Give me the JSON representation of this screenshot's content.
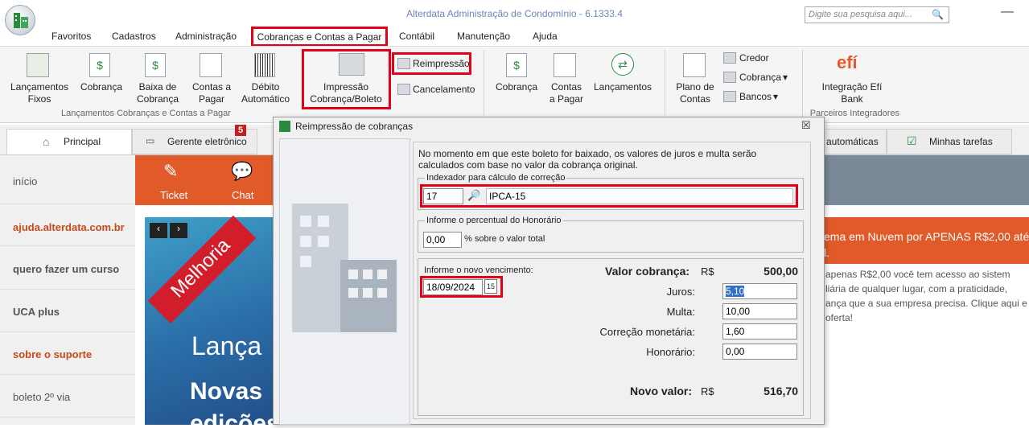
{
  "window": {
    "title": "Alterdata Administração de Condomínio - 6.1333.4",
    "search_placeholder": "Digite sua pesquisa aqui..."
  },
  "menu": [
    "Favoritos",
    "Cadastros",
    "Administração",
    "Cobranças e Contas a Pagar",
    "Contábil",
    "Manutenção",
    "Ajuda"
  ],
  "ribbon": {
    "lancamentos_fixos": "Lançamentos Fixos",
    "cobranca": "Cobrança",
    "baixa_de_cobranca": "Baixa de Cobrança",
    "contas_a_pagar": "Contas a Pagar",
    "debito_automatico": "Débito Automático",
    "impressao": "Impressão Cobrança/Boleto",
    "reimpressao": "Reimpressão",
    "cancelamento": "Cancelamento",
    "group1": "Lançamentos Cobranças e Contas a Pagar",
    "cobranca2": "Cobrança",
    "contas_a_pagar2": "Contas a Pagar",
    "lancamentos": "Lançamentos",
    "plano_de_contas": "Plano de Contas",
    "credor": "Credor",
    "cobranca3": "Cobrança",
    "bancos": "Bancos",
    "integracao": "Integração Efí Bank",
    "efi_logo": "efí",
    "group_integradores": "Parceiros Integradores"
  },
  "tabs": {
    "principal": "Principal",
    "gerente": "Gerente eletrônico",
    "gerente_badge": "5",
    "automaticas": "automáticas",
    "minhas_tarefas": "Minhas tarefas"
  },
  "nav": [
    "início",
    "ajuda.alterdata.com.br",
    "quero fazer um curso",
    "UCA plus",
    "sobre o suporte",
    "boleto 2º via"
  ],
  "quick": {
    "ticket": "Ticket",
    "chat": "Chat"
  },
  "banner": {
    "ribbon": "Melhoria",
    "line1": "Lança",
    "line2": "Novas",
    "line3": "edições"
  },
  "promo": {
    "title": "ema em Nuvem por APENAS R$2,00 até o",
    "title2": "l.",
    "body": [
      "apenas R$2,00 você tem acesso ao sistem",
      "liária de qualquer lugar, com a praticidade,",
      "ança que a sua empresa precisa. Clique aqui e g",
      "oferta!"
    ]
  },
  "dialog": {
    "title": "Reimpressão de cobranças",
    "info": "No momento em que este boleto for baixado, os valores de juros e multa serão calculados com base no valor da cobrança original.",
    "indexador_legend": "Indexador para cálculo de correção",
    "indexador_code": "17",
    "indexador_name": "IPCA-15",
    "honorario_legend": "Informe o percentual do Honorário",
    "honorario_pct": "0,00",
    "honorario_suffix": "% sobre o valor total",
    "venc_label": "Informe o novo vencimento:",
    "venc_date": "18/09/2024",
    "valor_cobranca_label": "Valor cobrança:",
    "currency": "R$",
    "valor_cobranca": "500,00",
    "juros_label": "Juros:",
    "juros": "5,10",
    "multa_label": "Multa:",
    "multa": "10,00",
    "correcao_label": "Correção monetária:",
    "correcao": "1,60",
    "honorario_label": "Honorário:",
    "honorario": "0,00",
    "novo_valor_label": "Novo valor:",
    "novo_valor": "516,70"
  }
}
